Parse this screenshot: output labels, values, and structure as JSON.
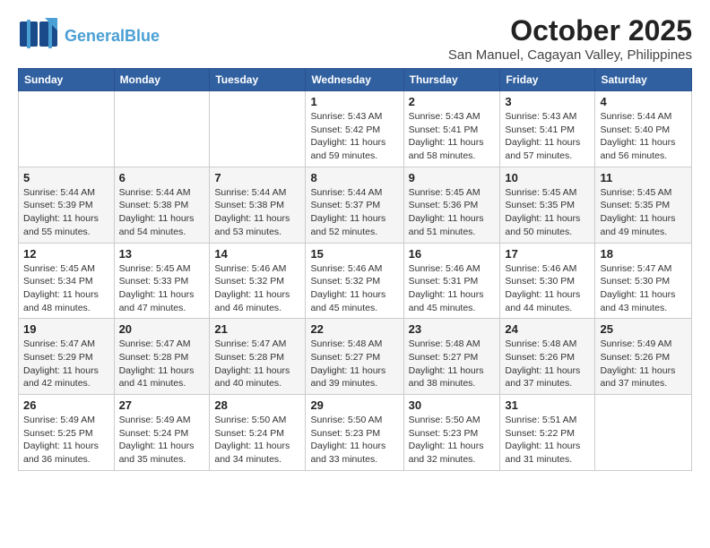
{
  "logo": {
    "line1": "General",
    "line2": "Blue"
  },
  "title": "October 2025",
  "subtitle": "San Manuel, Cagayan Valley, Philippines",
  "weekdays": [
    "Sunday",
    "Monday",
    "Tuesday",
    "Wednesday",
    "Thursday",
    "Friday",
    "Saturday"
  ],
  "weeks": [
    [
      {
        "day": "",
        "info": ""
      },
      {
        "day": "",
        "info": ""
      },
      {
        "day": "",
        "info": ""
      },
      {
        "day": "1",
        "info": "Sunrise: 5:43 AM\nSunset: 5:42 PM\nDaylight: 11 hours\nand 59 minutes."
      },
      {
        "day": "2",
        "info": "Sunrise: 5:43 AM\nSunset: 5:41 PM\nDaylight: 11 hours\nand 58 minutes."
      },
      {
        "day": "3",
        "info": "Sunrise: 5:43 AM\nSunset: 5:41 PM\nDaylight: 11 hours\nand 57 minutes."
      },
      {
        "day": "4",
        "info": "Sunrise: 5:44 AM\nSunset: 5:40 PM\nDaylight: 11 hours\nand 56 minutes."
      }
    ],
    [
      {
        "day": "5",
        "info": "Sunrise: 5:44 AM\nSunset: 5:39 PM\nDaylight: 11 hours\nand 55 minutes."
      },
      {
        "day": "6",
        "info": "Sunrise: 5:44 AM\nSunset: 5:38 PM\nDaylight: 11 hours\nand 54 minutes."
      },
      {
        "day": "7",
        "info": "Sunrise: 5:44 AM\nSunset: 5:38 PM\nDaylight: 11 hours\nand 53 minutes."
      },
      {
        "day": "8",
        "info": "Sunrise: 5:44 AM\nSunset: 5:37 PM\nDaylight: 11 hours\nand 52 minutes."
      },
      {
        "day": "9",
        "info": "Sunrise: 5:45 AM\nSunset: 5:36 PM\nDaylight: 11 hours\nand 51 minutes."
      },
      {
        "day": "10",
        "info": "Sunrise: 5:45 AM\nSunset: 5:35 PM\nDaylight: 11 hours\nand 50 minutes."
      },
      {
        "day": "11",
        "info": "Sunrise: 5:45 AM\nSunset: 5:35 PM\nDaylight: 11 hours\nand 49 minutes."
      }
    ],
    [
      {
        "day": "12",
        "info": "Sunrise: 5:45 AM\nSunset: 5:34 PM\nDaylight: 11 hours\nand 48 minutes."
      },
      {
        "day": "13",
        "info": "Sunrise: 5:45 AM\nSunset: 5:33 PM\nDaylight: 11 hours\nand 47 minutes."
      },
      {
        "day": "14",
        "info": "Sunrise: 5:46 AM\nSunset: 5:32 PM\nDaylight: 11 hours\nand 46 minutes."
      },
      {
        "day": "15",
        "info": "Sunrise: 5:46 AM\nSunset: 5:32 PM\nDaylight: 11 hours\nand 45 minutes."
      },
      {
        "day": "16",
        "info": "Sunrise: 5:46 AM\nSunset: 5:31 PM\nDaylight: 11 hours\nand 45 minutes."
      },
      {
        "day": "17",
        "info": "Sunrise: 5:46 AM\nSunset: 5:30 PM\nDaylight: 11 hours\nand 44 minutes."
      },
      {
        "day": "18",
        "info": "Sunrise: 5:47 AM\nSunset: 5:30 PM\nDaylight: 11 hours\nand 43 minutes."
      }
    ],
    [
      {
        "day": "19",
        "info": "Sunrise: 5:47 AM\nSunset: 5:29 PM\nDaylight: 11 hours\nand 42 minutes."
      },
      {
        "day": "20",
        "info": "Sunrise: 5:47 AM\nSunset: 5:28 PM\nDaylight: 11 hours\nand 41 minutes."
      },
      {
        "day": "21",
        "info": "Sunrise: 5:47 AM\nSunset: 5:28 PM\nDaylight: 11 hours\nand 40 minutes."
      },
      {
        "day": "22",
        "info": "Sunrise: 5:48 AM\nSunset: 5:27 PM\nDaylight: 11 hours\nand 39 minutes."
      },
      {
        "day": "23",
        "info": "Sunrise: 5:48 AM\nSunset: 5:27 PM\nDaylight: 11 hours\nand 38 minutes."
      },
      {
        "day": "24",
        "info": "Sunrise: 5:48 AM\nSunset: 5:26 PM\nDaylight: 11 hours\nand 37 minutes."
      },
      {
        "day": "25",
        "info": "Sunrise: 5:49 AM\nSunset: 5:26 PM\nDaylight: 11 hours\nand 37 minutes."
      }
    ],
    [
      {
        "day": "26",
        "info": "Sunrise: 5:49 AM\nSunset: 5:25 PM\nDaylight: 11 hours\nand 36 minutes."
      },
      {
        "day": "27",
        "info": "Sunrise: 5:49 AM\nSunset: 5:24 PM\nDaylight: 11 hours\nand 35 minutes."
      },
      {
        "day": "28",
        "info": "Sunrise: 5:50 AM\nSunset: 5:24 PM\nDaylight: 11 hours\nand 34 minutes."
      },
      {
        "day": "29",
        "info": "Sunrise: 5:50 AM\nSunset: 5:23 PM\nDaylight: 11 hours\nand 33 minutes."
      },
      {
        "day": "30",
        "info": "Sunrise: 5:50 AM\nSunset: 5:23 PM\nDaylight: 11 hours\nand 32 minutes."
      },
      {
        "day": "31",
        "info": "Sunrise: 5:51 AM\nSunset: 5:22 PM\nDaylight: 11 hours\nand 31 minutes."
      },
      {
        "day": "",
        "info": ""
      }
    ]
  ]
}
